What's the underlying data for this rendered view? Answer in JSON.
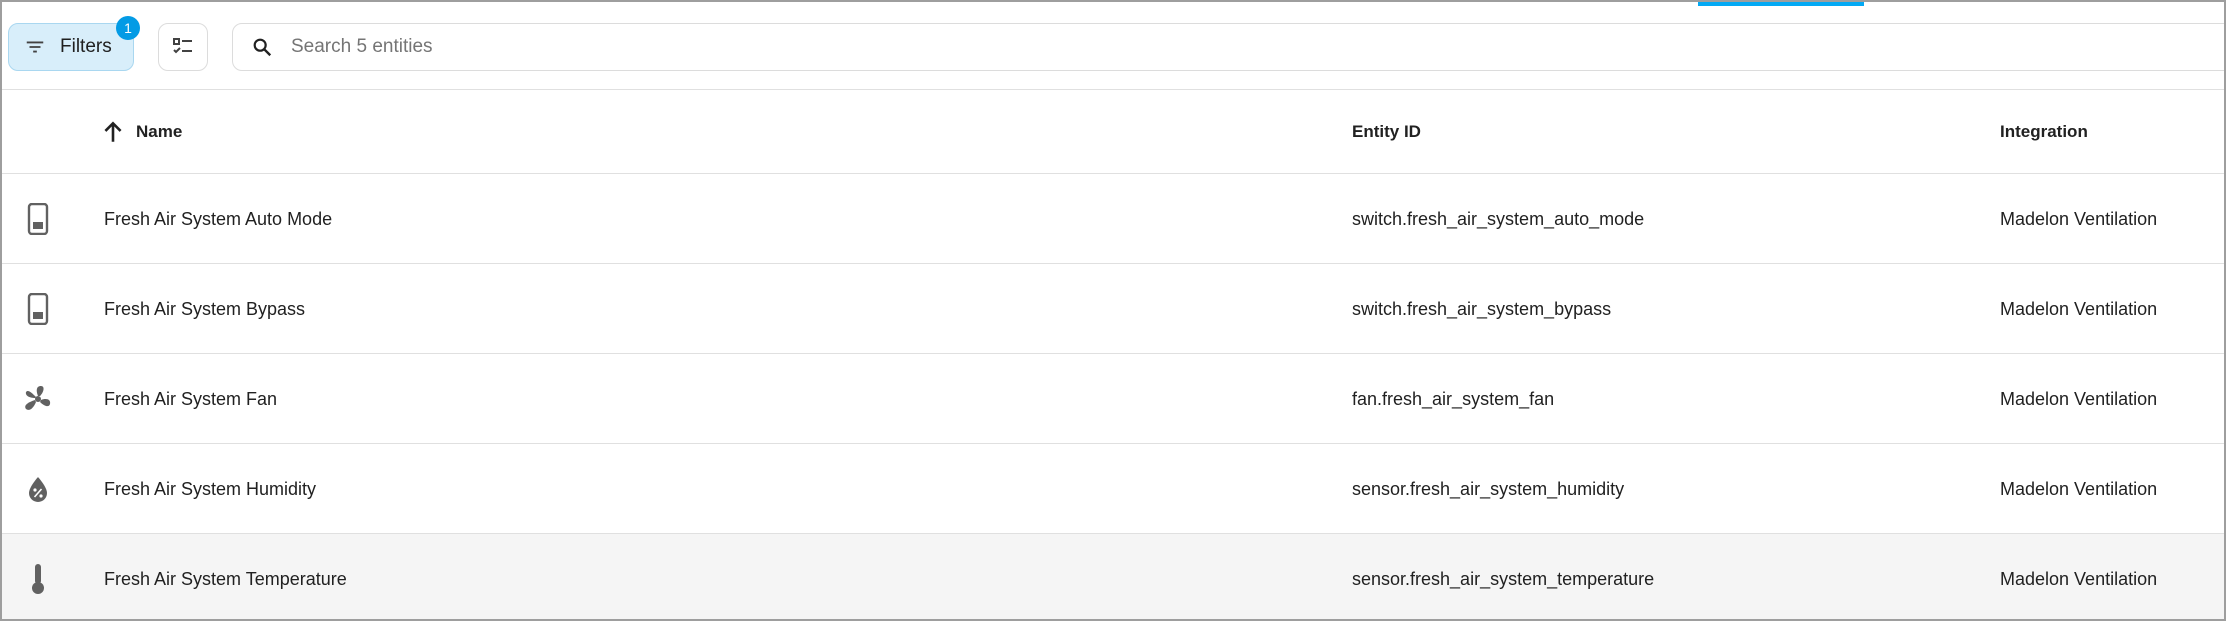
{
  "toolbar": {
    "filters_label": "Filters",
    "filters_badge": "1",
    "search_placeholder": "Search 5 entities"
  },
  "table": {
    "columns": {
      "name": "Name",
      "entity_id": "Entity ID",
      "integration": "Integration"
    },
    "sort": {
      "column": "name",
      "direction": "ascending"
    },
    "rows": [
      {
        "icon": "switch-icon",
        "name": "Fresh Air System Auto Mode",
        "entity_id": "switch.fresh_air_system_auto_mode",
        "integration": "Madelon Ventilation"
      },
      {
        "icon": "switch-icon",
        "name": "Fresh Air System Bypass",
        "entity_id": "switch.fresh_air_system_bypass",
        "integration": "Madelon Ventilation"
      },
      {
        "icon": "fan-icon",
        "name": "Fresh Air System Fan",
        "entity_id": "fan.fresh_air_system_fan",
        "integration": "Madelon Ventilation"
      },
      {
        "icon": "humidity-icon",
        "name": "Fresh Air System Humidity",
        "entity_id": "sensor.fresh_air_system_humidity",
        "integration": "Madelon Ventilation"
      },
      {
        "icon": "thermometer-icon",
        "name": "Fresh Air System Temperature",
        "entity_id": "sensor.fresh_air_system_temperature",
        "integration": "Madelon Ventilation"
      }
    ]
  },
  "colors": {
    "accent": "#03a9f4",
    "badge": "#039be5",
    "filters_bg": "#d8eefa",
    "icon": "#616161",
    "row_hover": "#f5f5f5"
  }
}
